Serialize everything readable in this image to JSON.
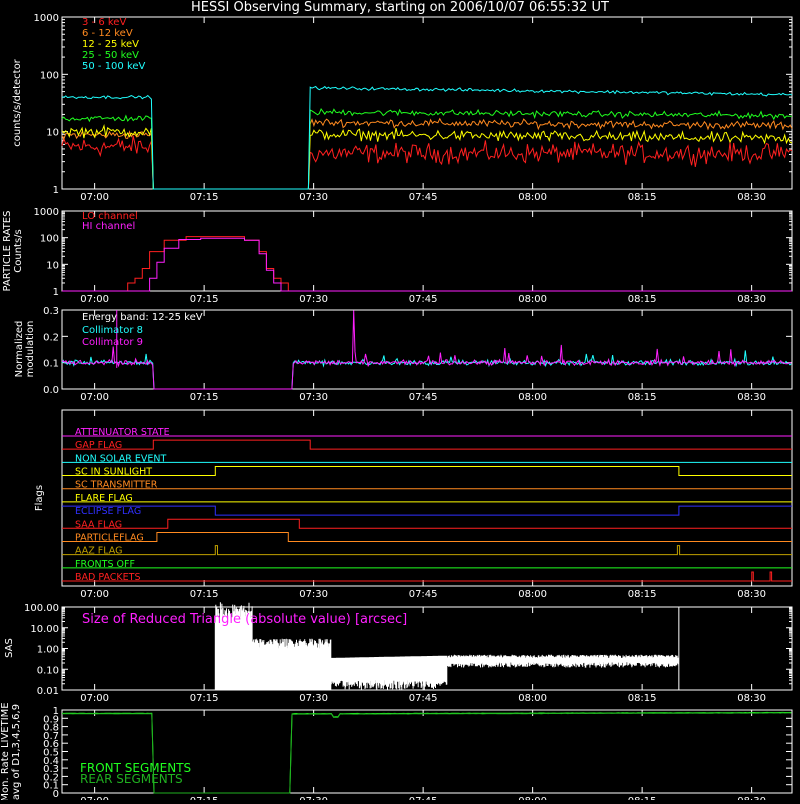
{
  "title": "HESSI Observing Summary, starting on 2006/10/07 06:55:32 UT",
  "time_ticks": [
    "07:00",
    "07:15",
    "07:30",
    "07:45",
    "08:00",
    "08:15",
    "08:30"
  ],
  "colors": {
    "red": "#ff2020",
    "orange": "#ff8a20",
    "yellow": "#ffff00",
    "green": "#20ff20",
    "cyan": "#20ffff",
    "magenta": "#ff20ff",
    "blue": "#3030ff",
    "olive": "#c0a000",
    "white": "#ffffff",
    "dkgreen": "#20b020"
  },
  "chart_data": [
    {
      "id": "counts",
      "type": "line",
      "ylabel": "counts/s/detector",
      "yscale": "log",
      "ylim": [
        1,
        1000
      ],
      "yticks": [
        "1",
        "10",
        "100",
        "1000"
      ],
      "xlim_min": [
        0,
        100
      ],
      "gap_min": [
        12.5,
        34.0
      ],
      "legend_position": "top-left",
      "series": [
        {
          "name": "3 - 6 keV",
          "color": "red",
          "before": 5.5,
          "after": 4.2,
          "noise": 0.25
        },
        {
          "name": "6 - 12 keV",
          "color": "orange",
          "before": 8.8,
          "after": 14.5,
          "after_end": 12.8,
          "noise": 0.1
        },
        {
          "name": "12 - 25 keV",
          "color": "yellow",
          "before": 10.0,
          "after": 9.0,
          "after_end": 7.5,
          "noise": 0.14
        },
        {
          "name": "25 - 50 keV",
          "color": "green",
          "before": 17.0,
          "after": 22.0,
          "after_end": 19.0,
          "noise": 0.08
        },
        {
          "name": "50 - 100 keV",
          "color": "cyan",
          "before": 40.0,
          "after": 58.0,
          "after_end": 44.0,
          "noise": 0.04
        }
      ]
    },
    {
      "id": "particle",
      "type": "line",
      "ylabel_lines": [
        "PARTICLE RATES",
        "Counts/s"
      ],
      "yscale": "log",
      "ylim": [
        1,
        1000
      ],
      "yticks": [
        "1",
        "10",
        "100",
        "1000"
      ],
      "legend_position": "top-left",
      "series": [
        {
          "name": "LO channel",
          "color": "red",
          "x_min": [
            0,
            7,
            9,
            10,
            11,
            12,
            14,
            17,
            21,
            25,
            27,
            28,
            29,
            30,
            31,
            100
          ],
          "y": [
            1,
            1,
            2,
            3,
            7,
            30,
            80,
            110,
            110,
            80,
            30,
            7,
            3,
            2,
            1,
            1
          ]
        },
        {
          "name": "HI channel",
          "color": "magenta",
          "x_min": [
            0,
            11,
            12,
            13,
            14,
            16,
            19,
            22,
            25,
            27,
            28,
            29,
            30,
            100
          ],
          "y": [
            1,
            1,
            3,
            12,
            40,
            85,
            95,
            95,
            80,
            25,
            6,
            2,
            1,
            1
          ]
        }
      ]
    },
    {
      "id": "modulation",
      "type": "line",
      "ylabel_lines": [
        "Normalized",
        "modulation"
      ],
      "ylim": [
        0,
        0.3
      ],
      "yticks": [
        "0.0",
        "0.1",
        "0.2",
        "0.3"
      ],
      "annotation": "Energy band: 12-25 keV",
      "gap_min": [
        12.5,
        31.5
      ],
      "series": [
        {
          "name": "Collimator 8",
          "color": "cyan",
          "level": 0.1,
          "noise": 0.015
        },
        {
          "name": "Collimator 9",
          "color": "magenta",
          "level": 0.1,
          "noise": 0.015
        }
      ]
    },
    {
      "id": "flags",
      "type": "line",
      "ylabel": "Flags",
      "rows": [
        {
          "name": "ATTENUATOR STATE",
          "color": "magenta",
          "segments": []
        },
        {
          "name": "GAP FLAG",
          "color": "red",
          "segments": [
            [
              12.5,
              34.0
            ]
          ]
        },
        {
          "name": "NON SOLAR EVENT",
          "color": "cyan",
          "segments": []
        },
        {
          "name": "SC IN SUNLIGHT",
          "color": "yellow",
          "segments": [
            [
              21.0,
              84.5
            ]
          ]
        },
        {
          "name": "SC TRANSMITTER",
          "color": "orange",
          "segments": []
        },
        {
          "name": "FLARE FLAG",
          "color": "yellow",
          "segments": []
        },
        {
          "name": "ECLIPSE FLAG",
          "color": "blue",
          "segments": [
            [
              0,
              21.0
            ],
            [
              84.5,
              100
            ]
          ]
        },
        {
          "name": "SAA FLAG",
          "color": "red",
          "segments": [
            [
              14.5,
              32.5
            ]
          ]
        },
        {
          "name": "PARTICLEFLAG",
          "color": "orange",
          "segments": [
            [
              13.0,
              31.0
            ]
          ]
        },
        {
          "name": "AAZ FLAG",
          "color": "olive",
          "segments": [
            [
              21.0,
              21.3
            ],
            [
              84.3,
              84.6
            ]
          ]
        },
        {
          "name": "FRONTS OFF",
          "color": "green",
          "segments": []
        },
        {
          "name": "BAD PACKETS",
          "color": "red",
          "segments": [
            [
              94.5,
              94.7
            ],
            [
              97.0,
              97.2
            ]
          ]
        }
      ]
    },
    {
      "id": "sas",
      "type": "line",
      "ylabel": "SAS",
      "yscale": "log",
      "ylim": [
        0.01,
        100
      ],
      "yticks": [
        "0.01",
        "0.10",
        "1.00",
        "10.00",
        "100.00"
      ],
      "annotation": "Size of Reduced Triangle (absolute value) [arcsec]",
      "x_min": [
        21.0,
        84.5
      ],
      "color": "white"
    },
    {
      "id": "livetime",
      "type": "line",
      "ylabel_lines": [
        "Mon. Rate LIVETIME",
        "avg of D1,3,4,5,6,9"
      ],
      "ylim": [
        0,
        1.0
      ],
      "yticks": [
        "0",
        "0.1",
        "0.2",
        "0.3",
        "0.4",
        "0.5",
        "0.6",
        "0.7",
        "0.8",
        "0.9",
        "1"
      ],
      "gap_min": [
        12.5,
        31.5
      ],
      "series": [
        {
          "name": "FRONT SEGMENTS",
          "color": "green",
          "before": 0.96,
          "after": 0.955,
          "after_end": 0.97
        },
        {
          "name": "REAR SEGMENTS",
          "color": "dkgreen",
          "before": 0.955,
          "after": 0.95,
          "after_end": 0.965
        }
      ]
    }
  ]
}
